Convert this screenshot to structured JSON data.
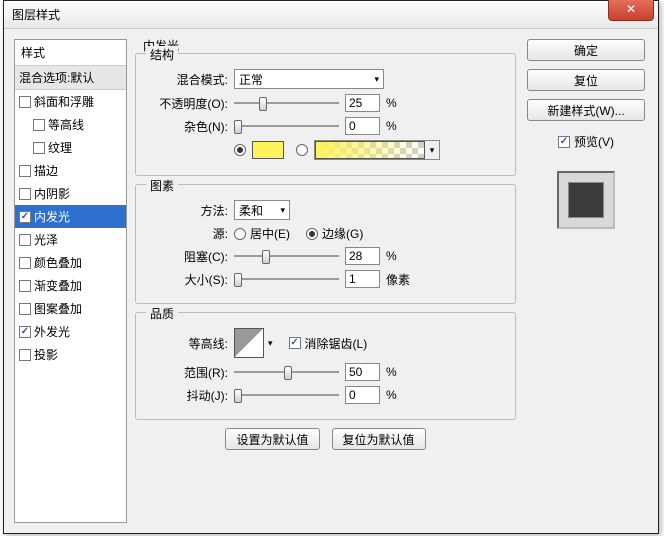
{
  "window": {
    "title": "图层样式"
  },
  "sidebar": {
    "header": "样式",
    "blend_options": "混合选项:默认",
    "items": [
      {
        "label": "斜面和浮雕",
        "checked": false,
        "indent": false
      },
      {
        "label": "等高线",
        "checked": false,
        "indent": true
      },
      {
        "label": "纹理",
        "checked": false,
        "indent": true
      },
      {
        "label": "描边",
        "checked": false,
        "indent": false
      },
      {
        "label": "内阴影",
        "checked": false,
        "indent": false
      },
      {
        "label": "内发光",
        "checked": true,
        "selected": true,
        "indent": false
      },
      {
        "label": "光泽",
        "checked": false,
        "indent": false
      },
      {
        "label": "颜色叠加",
        "checked": false,
        "indent": false
      },
      {
        "label": "渐变叠加",
        "checked": false,
        "indent": false
      },
      {
        "label": "图案叠加",
        "checked": false,
        "indent": false
      },
      {
        "label": "外发光",
        "checked": true,
        "indent": false
      },
      {
        "label": "投影",
        "checked": false,
        "indent": false
      }
    ]
  },
  "panel": {
    "title": "内发光",
    "structure": {
      "legend": "结构",
      "blend_mode_label": "混合模式:",
      "blend_mode_value": "正常",
      "opacity_label": "不透明度(O):",
      "opacity_value": "25",
      "opacity_unit": "%",
      "noise_label": "杂色(N):",
      "noise_value": "0",
      "noise_unit": "%",
      "color_mode": "solid"
    },
    "elements": {
      "legend": "图素",
      "technique_label": "方法:",
      "technique_value": "柔和",
      "source_label": "源:",
      "source_center": "居中(E)",
      "source_edge": "边缘(G)",
      "source_selected": "edge",
      "choke_label": "阻塞(C):",
      "choke_value": "28",
      "choke_unit": "%",
      "size_label": "大小(S):",
      "size_value": "1",
      "size_unit": "像素"
    },
    "quality": {
      "legend": "品质",
      "contour_label": "等高线:",
      "antialias_label": "消除锯齿(L)",
      "antialias_checked": true,
      "range_label": "范围(R):",
      "range_value": "50",
      "range_unit": "%",
      "jitter_label": "抖动(J):",
      "jitter_value": "0",
      "jitter_unit": "%"
    },
    "buttons": {
      "make_default": "设置为默认值",
      "reset_default": "复位为默认值"
    }
  },
  "right": {
    "ok": "确定",
    "cancel": "复位",
    "new_style": "新建样式(W)...",
    "preview_label": "预览(V)",
    "preview_checked": true
  }
}
